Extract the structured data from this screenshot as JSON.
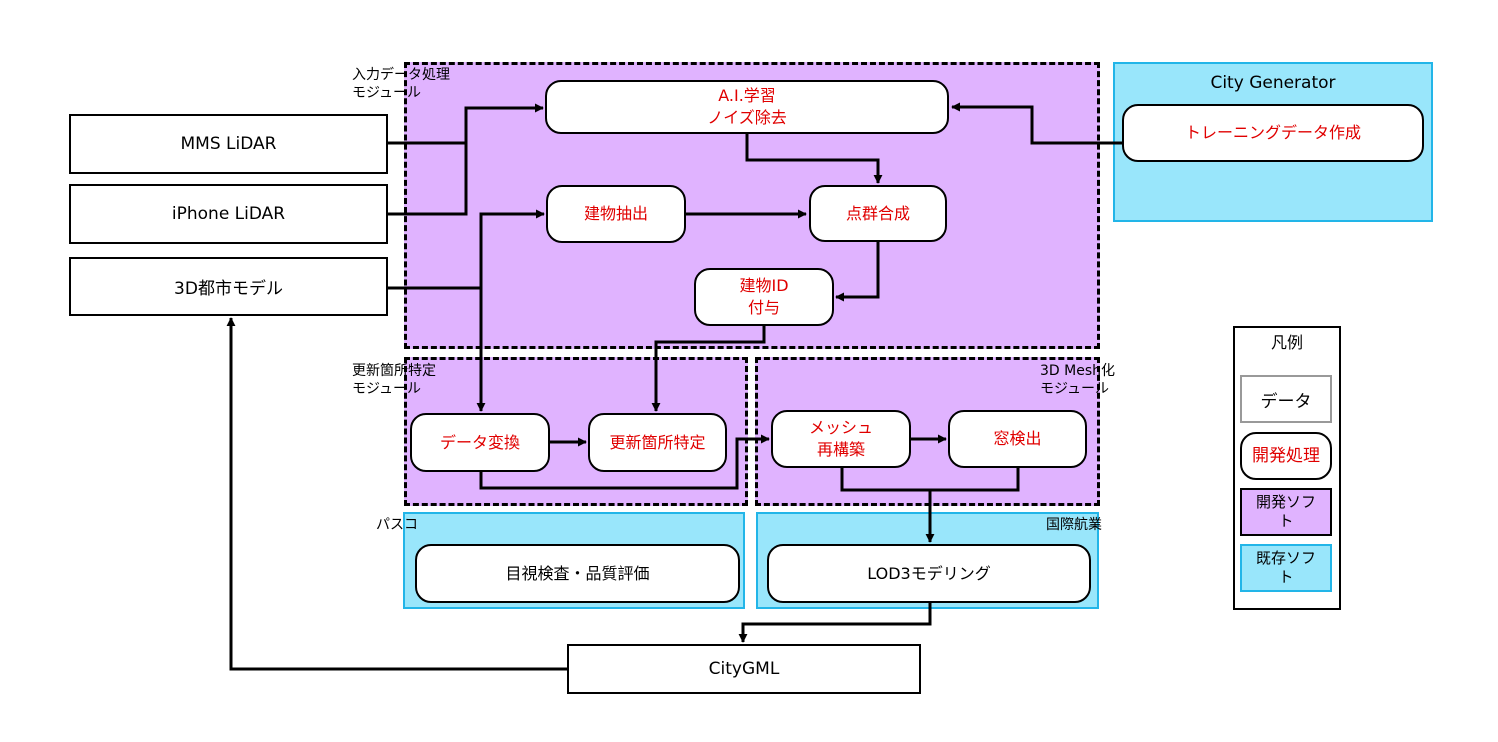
{
  "modules": {
    "input": {
      "label": "入力データ処理\nモジュール"
    },
    "update": {
      "label": "更新箇所特定\nモジュール"
    },
    "mesh": {
      "label": "3D Mesh化\nモジュール"
    },
    "city_generator": {
      "label": "City Generator"
    },
    "pasco": {
      "label": "パスコ"
    },
    "kokusai": {
      "label": "国際航業"
    }
  },
  "data_nodes": {
    "mms": "MMS LiDAR",
    "iphone": "iPhone LiDAR",
    "city3d": "3D都市モデル",
    "citygml": "CityGML"
  },
  "process_nodes": {
    "ai": "A.I.学習\nノイズ除去",
    "training": "トレーニングデータ作成",
    "building_extract": "建物抽出",
    "point_merge": "点群合成",
    "building_id": "建物ID\n付与",
    "data_convert": "データ変換",
    "update_detect": "更新箇所特定",
    "mesh_rebuild": "メッシュ\n再構築",
    "window_detect": "窓検出",
    "visual_check": "目視検査・品質評価",
    "lod3": "LOD3モデリング"
  },
  "legend": {
    "title": "凡例",
    "data": "データ",
    "process": "開発処理",
    "dev_soft": "開発ソフト",
    "existing_soft": "既存ソフト"
  },
  "colors": {
    "process_text": "#e00000",
    "module_fill": "#e0b3ff",
    "existing_fill": "#99e6fb",
    "existing_border": "#22b5e8"
  }
}
